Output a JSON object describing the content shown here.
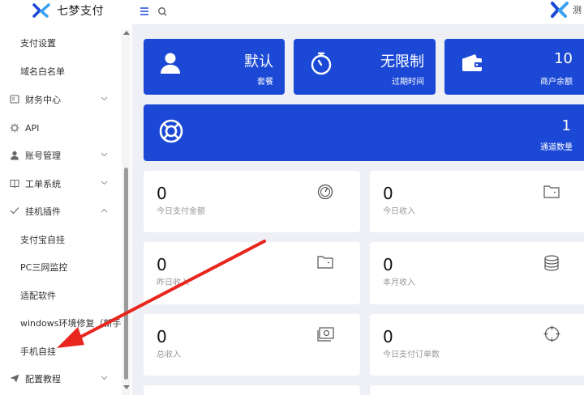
{
  "header": {
    "brand_name": "七梦支付",
    "username_fragment": "测"
  },
  "sidebar": {
    "items": [
      {
        "label": "支付设置"
      },
      {
        "label": "域名白名单"
      },
      {
        "label": "财务中心"
      },
      {
        "label": "API"
      },
      {
        "label": "账号管理"
      },
      {
        "label": "工单系统"
      },
      {
        "label": "挂机插件"
      },
      {
        "label": "支付宝自挂"
      },
      {
        "label": "PC三网监控"
      },
      {
        "label": "适配软件"
      },
      {
        "label": "windows环境修复（新手系统"
      },
      {
        "label": "手机自挂"
      },
      {
        "label": "配置教程"
      }
    ]
  },
  "cards": {
    "package": {
      "value": "默认",
      "label": "套餐"
    },
    "expire": {
      "value": "无限制",
      "label": "过期时间"
    },
    "balance": {
      "value": "10",
      "label": "商户余额"
    },
    "channels": {
      "value": "1",
      "label": "通道数量"
    }
  },
  "stats": {
    "today_pay_amount": {
      "value": "0",
      "label": "今日支付金额"
    },
    "today_income": {
      "value": "0",
      "label": "今日收入"
    },
    "yesterday_income": {
      "value": "0",
      "label": "昨日收入"
    },
    "month_income": {
      "value": "0",
      "label": "本月收入"
    },
    "total_income": {
      "value": "0",
      "label": "总收入"
    },
    "today_orders": {
      "value": "0",
      "label": "今日支付订单数"
    }
  },
  "colors": {
    "primary_card": "#1b49d6",
    "annotation_arrow": "#e8261e"
  }
}
